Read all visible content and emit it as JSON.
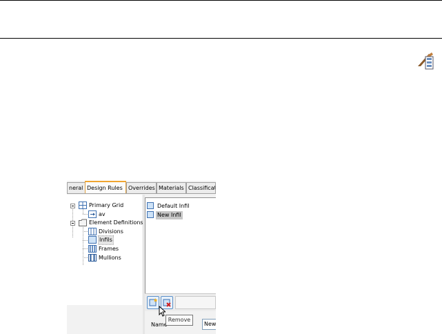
{
  "tabs": [
    {
      "label": "neral",
      "active": false
    },
    {
      "label": "Design Rules",
      "active": true
    },
    {
      "label": "Overrides",
      "active": false
    },
    {
      "label": "Materials",
      "active": false
    },
    {
      "label": "Classificat",
      "active": false
    }
  ],
  "tree": {
    "primary_grid": "Primary Grid",
    "grid_child": "av",
    "element_definitions": "Element Definitions",
    "divisions": "Divisions",
    "infills": "Infils",
    "frames": "Frames",
    "mullions": "Mullions"
  },
  "list": {
    "items": [
      "Default Infil",
      "New Infil"
    ],
    "selected_index": 1
  },
  "toolbar": {
    "add_icon": "add-infill-icon",
    "remove_icon": "remove-infill-icon"
  },
  "tooltip": "Remove",
  "form": {
    "name_label": "Name",
    "name_value": "New"
  },
  "colors": {
    "active_tab_accent": "#f0a530",
    "selection_gray": "#c7c7c7",
    "icon_blue": "#3c6fb0"
  }
}
